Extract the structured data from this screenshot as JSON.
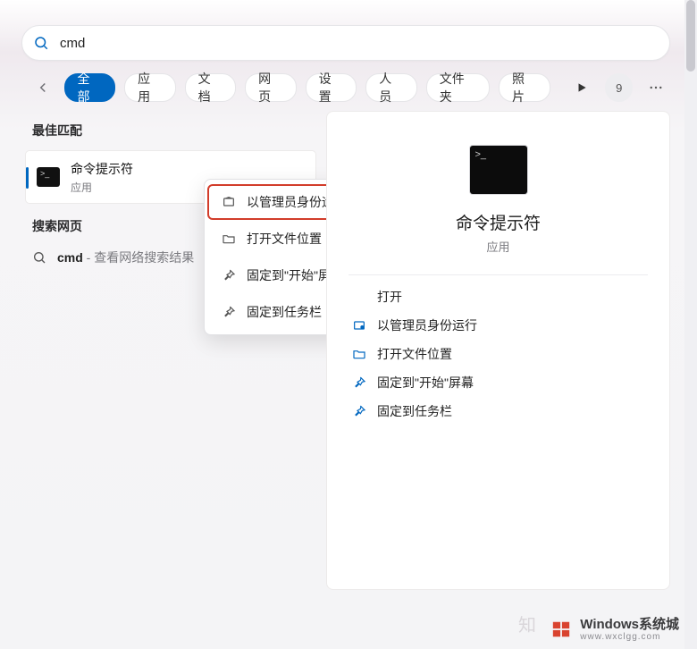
{
  "search": {
    "value": "cmd",
    "placeholder": ""
  },
  "tabs": {
    "items": [
      "全部",
      "应用",
      "文档",
      "网页",
      "设置",
      "人员",
      "文件夹",
      "照片"
    ],
    "active_index": 0,
    "badge_count": "9"
  },
  "sections": {
    "best_match": "最佳匹配",
    "search_web": "搜索网页"
  },
  "best_match": {
    "title": "命令提示符",
    "subtitle": "应用",
    "icon": "cmd-icon"
  },
  "web_result": {
    "query": "cmd",
    "suffix": " - 查看网络搜索结果"
  },
  "context_menu": {
    "items": [
      {
        "icon": "shield-icon",
        "label": "以管理员身份运行",
        "highlight": true
      },
      {
        "icon": "folder-icon",
        "label": "打开文件位置",
        "highlight": false
      },
      {
        "icon": "pin-icon",
        "label": "固定到\"开始\"屏幕",
        "highlight": false
      },
      {
        "icon": "pin-icon",
        "label": "固定到任务栏",
        "highlight": false
      }
    ]
  },
  "details": {
    "title": "命令提示符",
    "subtitle": "应用",
    "actions": [
      {
        "icon": "",
        "label": "打开"
      },
      {
        "icon": "shield-icon",
        "label": "以管理员身份运行"
      },
      {
        "icon": "folder-icon",
        "label": "打开文件位置"
      },
      {
        "icon": "pin-icon",
        "label": "固定到\"开始\"屏幕"
      },
      {
        "icon": "pin-icon",
        "label": "固定到任务栏"
      }
    ]
  },
  "watermark": {
    "faint": "知",
    "brand": "Windows系统城",
    "url": "www.wxclgg.com"
  },
  "icons": {
    "search-icon": "search",
    "back-icon": "back",
    "play-icon": "play",
    "more-icon": "more",
    "shield-icon": "shield",
    "folder-icon": "folder",
    "pin-icon": "pin",
    "cmd-icon": "cmd"
  }
}
